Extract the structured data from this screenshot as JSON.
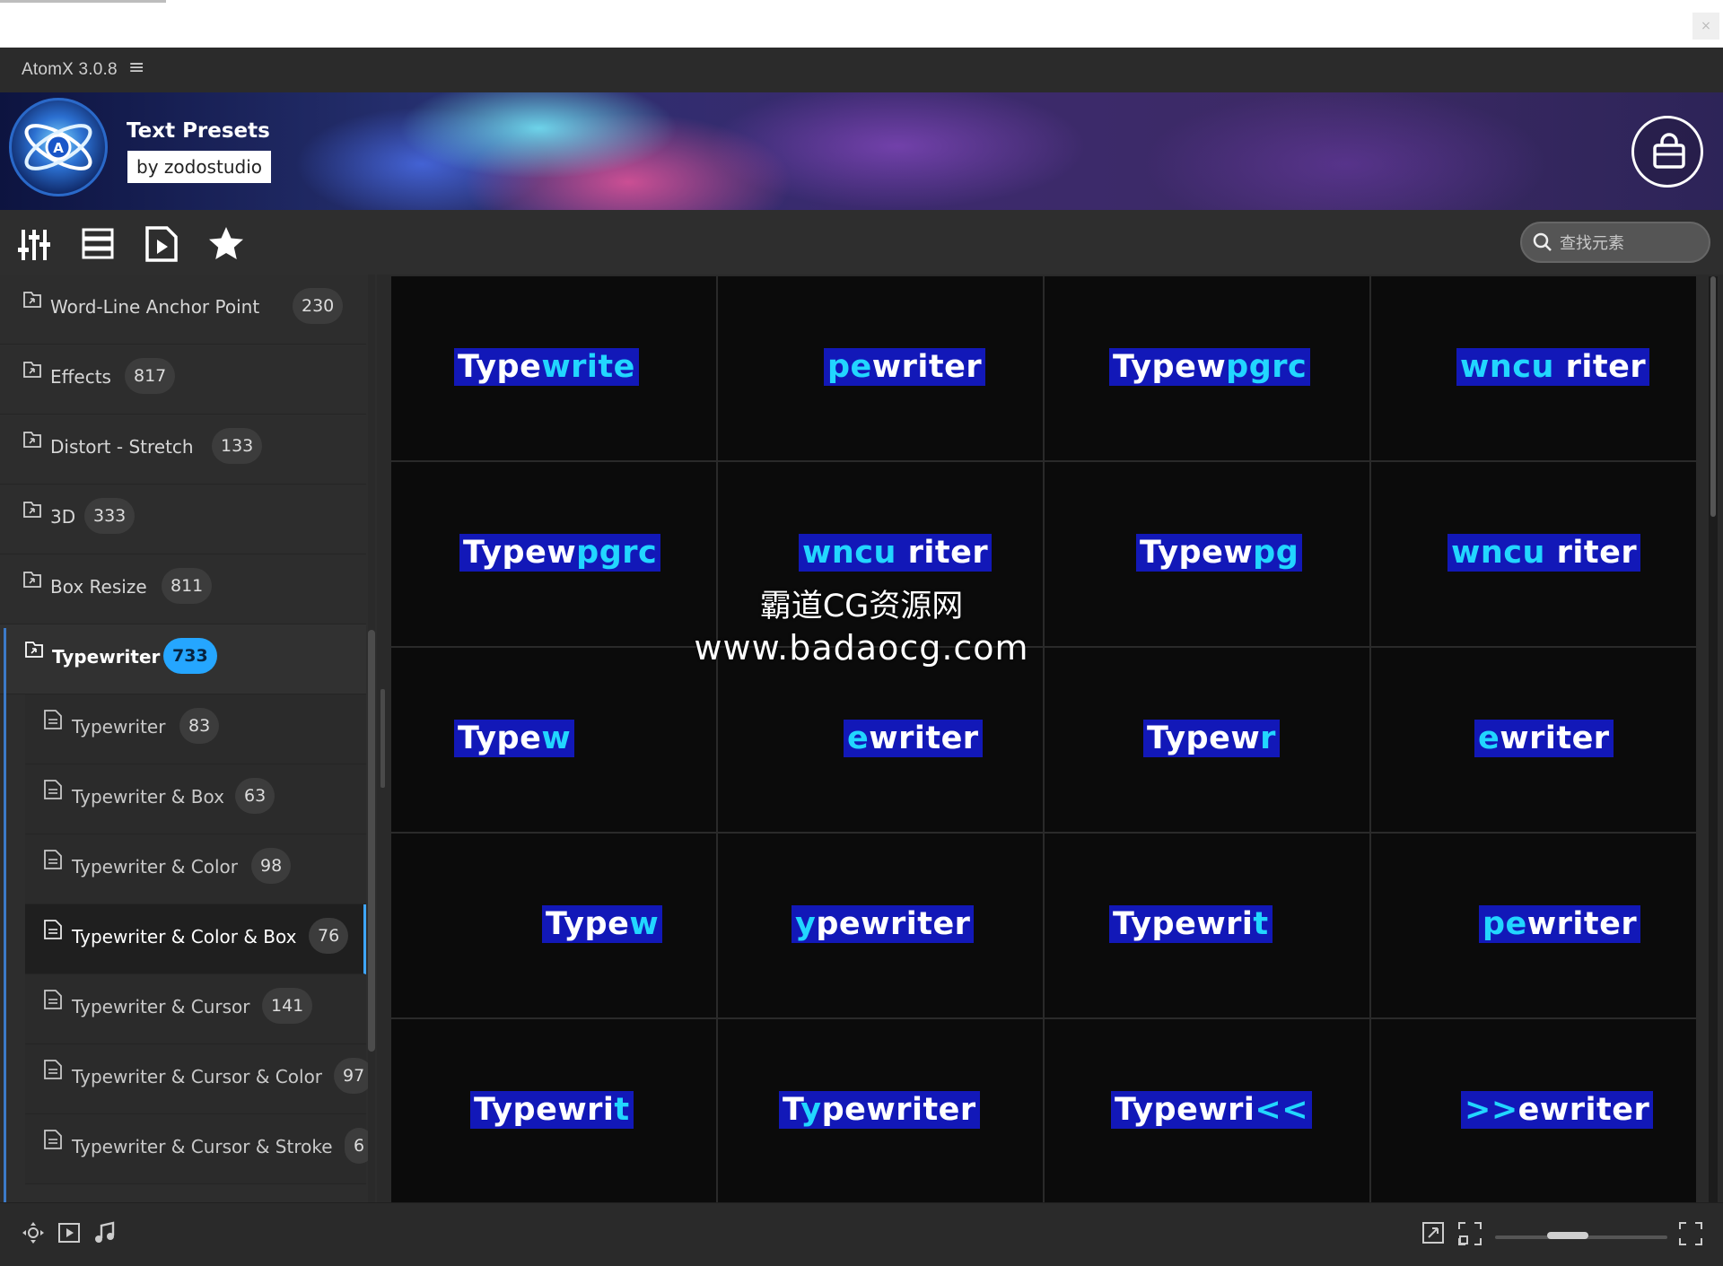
{
  "app": {
    "title": "AtomX 3.0.8",
    "menu_glyph": "≡"
  },
  "banner": {
    "title": "Text Presets",
    "byline": "by zodostudio",
    "logo_letter": "A"
  },
  "toolbar": {
    "tools": [
      "sliders-icon",
      "list-icon",
      "preview-icon",
      "star-icon"
    ],
    "search_placeholder": "查找元素"
  },
  "sidebar": {
    "items": [
      {
        "label": "Word-Line Anchor Point",
        "count": "230"
      },
      {
        "label": "Effects",
        "count": "817"
      },
      {
        "label": "Distort - Stretch",
        "count": "133"
      },
      {
        "label": "3D",
        "count": "333"
      },
      {
        "label": "Box Resize",
        "count": "811"
      },
      {
        "label": "Typewriter",
        "count": "733",
        "selected": true
      }
    ],
    "subitems": [
      {
        "label": "Typewriter",
        "count": "83"
      },
      {
        "label": "Typewriter & Box",
        "count": "63"
      },
      {
        "label": "Typewriter & Color",
        "count": "98"
      },
      {
        "label": "Typewriter & Color & Box",
        "count": "76",
        "active": true
      },
      {
        "label": "Typewriter & Cursor",
        "count": "141"
      },
      {
        "label": "Typewriter & Cursor & Color",
        "count": "97"
      },
      {
        "label": "Typewriter & Cursor & Stroke",
        "count": "6"
      }
    ]
  },
  "presets": [
    {
      "w": "Type",
      "c": "write"
    },
    {
      "w": "",
      "c": "pe",
      "w2": "wri",
      "c2": "",
      "w3": "ter"
    },
    {
      "w": "Typew",
      "c": "pgrc"
    },
    {
      "w": "",
      "c": "wncu",
      "w2": " riter"
    },
    {
      "w": "Typew",
      "c": "pgrc"
    },
    {
      "w": "",
      "c": "wncu",
      "w2": " riter"
    },
    {
      "w": "Typew",
      "c": "pg"
    },
    {
      "w": "",
      "c": "wncu",
      "w2": " riter"
    },
    {
      "w": "Type",
      "c": "w"
    },
    {
      "w": "",
      "c": "e",
      "w2": "writer"
    },
    {
      "w": "Typew",
      "c": "r"
    },
    {
      "w": "",
      "c": "e",
      "w2": "writer"
    },
    {
      "w": "Type",
      "c": "w"
    },
    {
      "w": "",
      "c": "y",
      "w2": "pewriter"
    },
    {
      "w": "Typewri",
      "c": "t"
    },
    {
      "w": "",
      "c": "pe",
      "w2": "writer"
    },
    {
      "w": "Typewri",
      "c": "t"
    },
    {
      "w": "T",
      "c": "y",
      "w2": "pewriter"
    },
    {
      "w": "Typewri",
      "c": "<<"
    },
    {
      "w": "",
      "c": ">>",
      "w2": "ewriter"
    }
  ],
  "watermark": {
    "line1": "霸道CG资源网",
    "line2": "www.badaocg.com"
  },
  "bottombar": {
    "tools": [
      "move-icon",
      "play-icon",
      "music-icon"
    ],
    "right_tools": [
      "export-icon",
      "fit-icon",
      "zoom-slider",
      "fullscreen-icon"
    ]
  },
  "colors": {
    "accent": "#25a6ff",
    "preview_box": "#1218b8",
    "preview_highlight": "#22d6ff"
  }
}
